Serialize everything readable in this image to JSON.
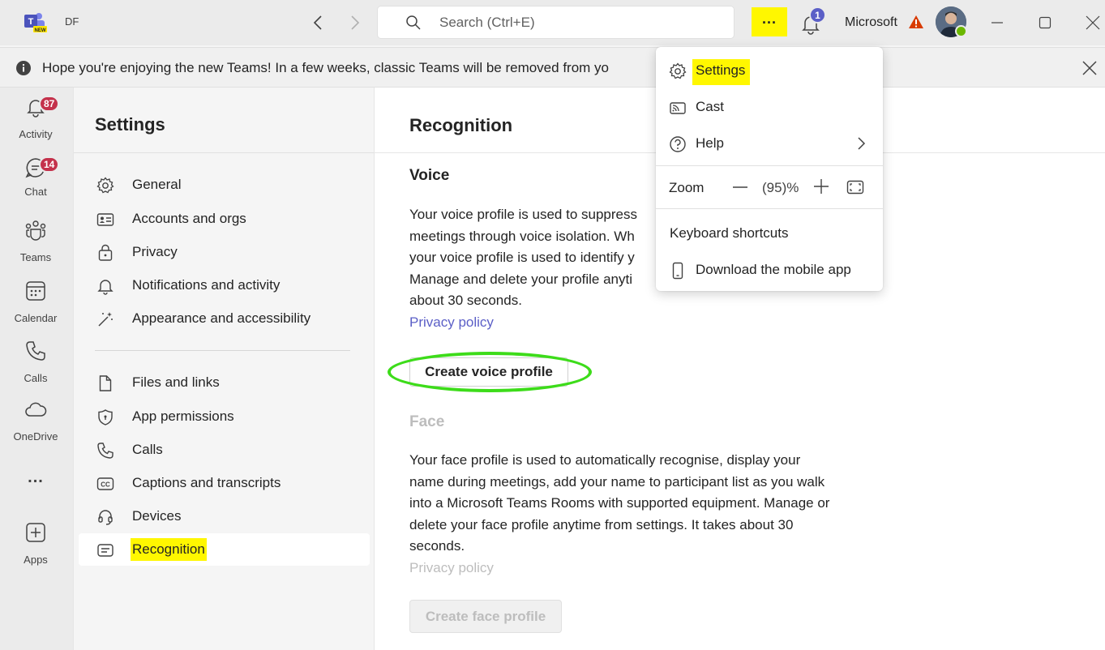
{
  "titlebar": {
    "org_initials": "DF",
    "search_placeholder": "Search (Ctrl+E)",
    "more_label": "...",
    "notification_count": "1",
    "org_name": "Microsoft"
  },
  "banner": {
    "text": "Hope you're enjoying the new Teams! In a few weeks, classic Teams will be removed from yo                                              eeded"
  },
  "rail": {
    "items": [
      {
        "label": "Activity",
        "badge": "87",
        "icon": "bell-icon"
      },
      {
        "label": "Chat",
        "badge": "14",
        "icon": "chat-icon"
      },
      {
        "label": "Teams",
        "icon": "teams-icon"
      },
      {
        "label": "Calendar",
        "icon": "calendar-icon"
      },
      {
        "label": "Calls",
        "icon": "phone-icon"
      },
      {
        "label": "OneDrive",
        "icon": "cloud-icon"
      },
      {
        "label": "Apps",
        "icon": "add-apps-icon"
      }
    ],
    "more_label": "..."
  },
  "settings": {
    "title": "Settings",
    "nav": [
      {
        "label": "General",
        "icon": "gear-icon"
      },
      {
        "label": "Accounts and orgs",
        "icon": "id-card-icon"
      },
      {
        "label": "Privacy",
        "icon": "lock-icon"
      },
      {
        "label": "Notifications and activity",
        "icon": "bell-icon"
      },
      {
        "label": "Appearance and accessibility",
        "icon": "magic-wand-icon"
      },
      {
        "label": "Files and links",
        "icon": "file-icon"
      },
      {
        "label": "App permissions",
        "icon": "shield-icon"
      },
      {
        "label": "Calls",
        "icon": "phone-icon"
      },
      {
        "label": "Captions and transcripts",
        "icon": "captions-icon"
      },
      {
        "label": "Devices",
        "icon": "headset-icon"
      },
      {
        "label": "Recognition",
        "icon": "recognition-icon"
      }
    ],
    "active": "Recognition"
  },
  "main": {
    "title": "Recognition",
    "voice": {
      "heading": "Voice",
      "lines": [
        "Your voice profile is used to suppress",
        "meetings through voice isolation. Wh",
        "your voice profile is used to identify y",
        "Manage and delete your profile anyti",
        "about 30 seconds."
      ],
      "privacy_link": "Privacy policy",
      "button": "Create voice profile"
    },
    "face": {
      "heading": "Face",
      "lines": [
        "Your face profile is used to automatically recognise, display your",
        "name during meetings, add your name to participant list as you walk",
        "into a Microsoft Teams Rooms with supported equipment. Manage or",
        "delete your face profile anytime from settings. It takes about 30",
        "seconds."
      ],
      "privacy_link": "Privacy policy",
      "button": "Create face profile"
    }
  },
  "menu": {
    "settings": "Settings",
    "cast": "Cast",
    "help": "Help",
    "zoom_label": "Zoom",
    "zoom_value": "(95)%",
    "keyboard_shortcuts": "Keyboard shortcuts",
    "download_app": "Download the mobile app"
  },
  "colors": {
    "highlight": "#fff700",
    "ellipse": "#3ddc1a",
    "accent": "#5b5fc7",
    "badge_red": "#c4314b"
  }
}
